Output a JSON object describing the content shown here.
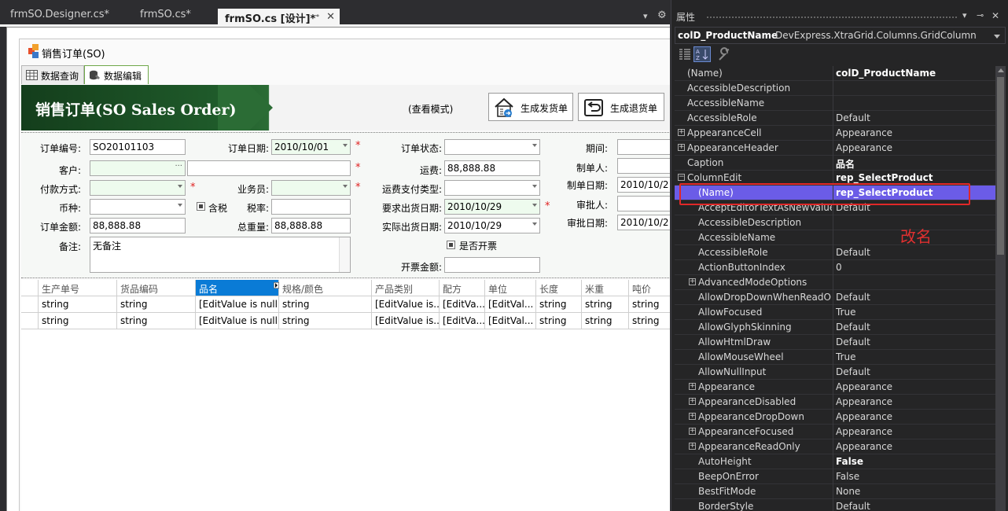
{
  "doc_tabs": [
    {
      "label": "frmSO.Designer.cs*"
    },
    {
      "label": "frmSO.cs*"
    },
    {
      "label": "frmSO.cs [设计]*"
    }
  ],
  "form": {
    "title": "销售订单(SO)",
    "inner_tabs": [
      "数据查询",
      "数据编辑"
    ],
    "banner_title": "销售订单(SO Sales Order)",
    "mode": "(查看模式)",
    "btn_delivery": "生成发货单",
    "btn_return": "生成退货单",
    "labels": {
      "order_no": "订单编号:",
      "order_date": "订单日期:",
      "order_status": "订单状态:",
      "period": "期间:",
      "customer": "客户:",
      "freight": "运费:",
      "creator": "制单人:",
      "payment": "付款方式:",
      "salesman": "业务员:",
      "freight_pay": "运费支付类型:",
      "create_date": "制单日期:",
      "currency": "币种:",
      "tax_incl": "含税",
      "tax_rate": "税率:",
      "req_ship": "要求出货日期:",
      "approver": "审批人:",
      "amount": "订单金额:",
      "total_weight": "总重量:",
      "actual_ship": "实际出货日期:",
      "approve_date": "审批日期:",
      "remark": "备注:",
      "invoice": "是否开票",
      "invoice_amount": "开票金额:"
    },
    "values": {
      "order_no": "SO20101103",
      "order_date": "2010/10/01",
      "freight": "88,888.88",
      "create_date": "2010/10/2",
      "req_ship": "2010/10/29",
      "amount": "88,888.88",
      "total_weight": "88,888.88",
      "actual_ship": "2010/10/29",
      "approve_date": "2010/10/2",
      "remark": "无备注"
    },
    "required_mark": "*",
    "grid": {
      "columns": [
        "生产单号",
        "货品编码",
        "品名",
        "规格/颜色",
        "产品类别",
        "配方",
        "单位",
        "长度",
        "米重",
        "吨价"
      ],
      "rows": [
        [
          "string",
          "string",
          "[EditValue is null]",
          "string",
          "[EditValue is...",
          "[EditVa...",
          "[EditVal...",
          "string",
          "string",
          "string"
        ],
        [
          "string",
          "string",
          "[EditValue is null]",
          "string",
          "[EditValue is...",
          "[EditVa...",
          "[EditVal...",
          "string",
          "string",
          "string"
        ]
      ]
    }
  },
  "props": {
    "title": "属性",
    "object_name": "colD_ProductName",
    "object_type": "DevExpress.XtraGrid.Columns.GridColumn",
    "rows": [
      {
        "name": "(Name)",
        "value": "colD_ProductName",
        "bold": true,
        "indent": 0
      },
      {
        "name": "AccessibleDescription",
        "value": "",
        "indent": 0
      },
      {
        "name": "AccessibleName",
        "value": "",
        "indent": 0
      },
      {
        "name": "AccessibleRole",
        "value": "Default",
        "indent": 0
      },
      {
        "name": "AppearanceCell",
        "value": "Appearance",
        "expander": "+",
        "indent": 0
      },
      {
        "name": "AppearanceHeader",
        "value": "Appearance",
        "expander": "+",
        "indent": 0
      },
      {
        "name": "Caption",
        "value": "品名",
        "bold": true,
        "indent": 0
      },
      {
        "name": "ColumnEdit",
        "value": "rep_SelectProduct",
        "bold": true,
        "expander": "−",
        "indent": 0
      },
      {
        "name": "(Name)",
        "value": "rep_SelectProduct",
        "bold": true,
        "indent": 1,
        "selected": true
      },
      {
        "name": "AcceptEditorTextAsNewValue",
        "value": "Default",
        "indent": 1
      },
      {
        "name": "AccessibleDescription",
        "value": "",
        "indent": 1
      },
      {
        "name": "AccessibleName",
        "value": "",
        "indent": 1
      },
      {
        "name": "AccessibleRole",
        "value": "Default",
        "indent": 1
      },
      {
        "name": "ActionButtonIndex",
        "value": "0",
        "indent": 1
      },
      {
        "name": "AdvancedModeOptions",
        "value": "",
        "expander": "+",
        "indent": 1
      },
      {
        "name": "AllowDropDownWhenReadOnly",
        "value": "Default",
        "indent": 1
      },
      {
        "name": "AllowFocused",
        "value": "True",
        "indent": 1
      },
      {
        "name": "AllowGlyphSkinning",
        "value": "Default",
        "indent": 1
      },
      {
        "name": "AllowHtmlDraw",
        "value": "Default",
        "indent": 1
      },
      {
        "name": "AllowMouseWheel",
        "value": "True",
        "indent": 1
      },
      {
        "name": "AllowNullInput",
        "value": "Default",
        "indent": 1
      },
      {
        "name": "Appearance",
        "value": "Appearance",
        "expander": "+",
        "indent": 1
      },
      {
        "name": "AppearanceDisabled",
        "value": "Appearance",
        "expander": "+",
        "indent": 1
      },
      {
        "name": "AppearanceDropDown",
        "value": "Appearance",
        "expander": "+",
        "indent": 1
      },
      {
        "name": "AppearanceFocused",
        "value": "Appearance",
        "expander": "+",
        "indent": 1
      },
      {
        "name": "AppearanceReadOnly",
        "value": "Appearance",
        "expander": "+",
        "indent": 1
      },
      {
        "name": "AutoHeight",
        "value": "False",
        "bold": true,
        "indent": 1
      },
      {
        "name": "BeepOnError",
        "value": "False",
        "indent": 1
      },
      {
        "name": "BestFitMode",
        "value": "None",
        "indent": 1
      },
      {
        "name": "BorderStyle",
        "value": "Default",
        "indent": 1
      }
    ]
  },
  "annotation": "改名",
  "colors": {
    "accent": "#6b5ce7",
    "highlight": "#e02828",
    "banner": "#1f5a2a"
  }
}
